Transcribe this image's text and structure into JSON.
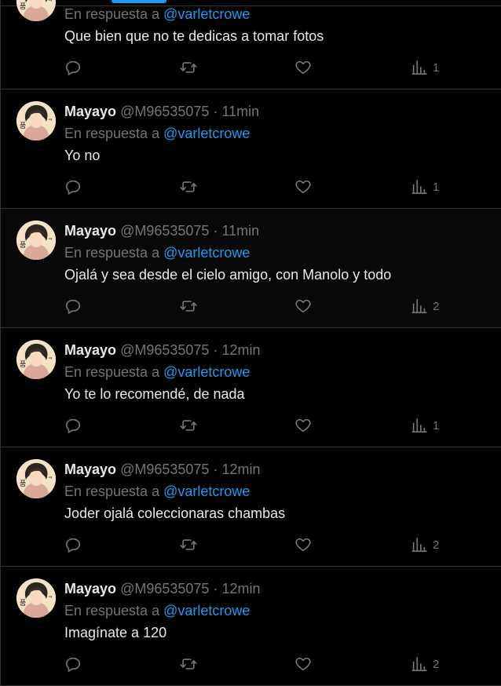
{
  "reply_prefix": "En respuesta a",
  "tweets": [
    {
      "name": "",
      "handle": "",
      "time": "",
      "reply_to": "@varletcrowe",
      "text": "Que bien que no te dedicas a tomar fotos",
      "views": "1"
    },
    {
      "name": "Mayayo",
      "handle": "@M96535075",
      "time": "11min",
      "reply_to": "@varletcrowe",
      "text": "Yo no",
      "views": "1"
    },
    {
      "name": "Mayayo",
      "handle": "@M96535075",
      "time": "11min",
      "reply_to": "@varletcrowe",
      "text": "Ojalá y sea desde el cielo amigo, con Manolo y todo",
      "views": "2"
    },
    {
      "name": "Mayayo",
      "handle": "@M96535075",
      "time": "12min",
      "reply_to": "@varletcrowe",
      "text": "Yo te lo recomendé, de nada",
      "views": "1"
    },
    {
      "name": "Mayayo",
      "handle": "@M96535075",
      "time": "12min",
      "reply_to": "@varletcrowe",
      "text": "Joder ojalá coleccionaras chambas",
      "views": "2"
    },
    {
      "name": "Mayayo",
      "handle": "@M96535075",
      "time": "12min",
      "reply_to": "@varletcrowe",
      "text": "Imagínate a 120",
      "views": "2"
    }
  ],
  "colors": {
    "accent": "#1d9bf0",
    "muted": "#71767b",
    "text": "#e7e9ea",
    "border": "#2f3336"
  }
}
